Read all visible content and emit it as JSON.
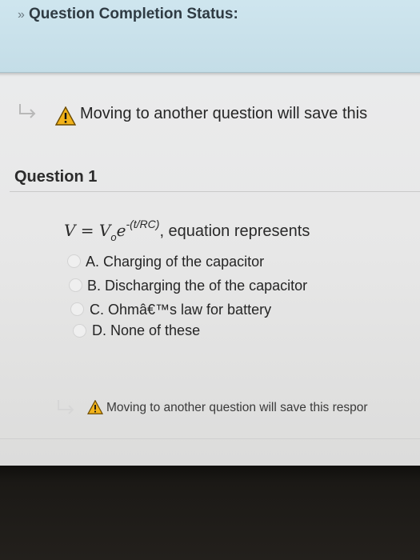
{
  "status": {
    "title": "Question Completion Status:",
    "collapse_icon": "collapse-arrow-icon"
  },
  "warning_top": {
    "text": "Moving to another question will save this"
  },
  "question": {
    "title": "Question 1",
    "equation": {
      "lhs": "V = V",
      "sub": "o",
      "base": "e",
      "exponent": "-(t/RC)",
      "suffix": ", equation represents"
    },
    "options": [
      {
        "label": "A. Charging of the capacitor"
      },
      {
        "label": "B. Discharging the of the capacitor"
      },
      {
        "label": "C. Ohmâ€™s law for battery"
      },
      {
        "label": "D. None of these"
      }
    ]
  },
  "warning_bottom": {
    "text": "Moving to another question will save this respor"
  },
  "colors": {
    "panel": "#c9e2ec",
    "warning_triangle": "#f2b31a"
  }
}
